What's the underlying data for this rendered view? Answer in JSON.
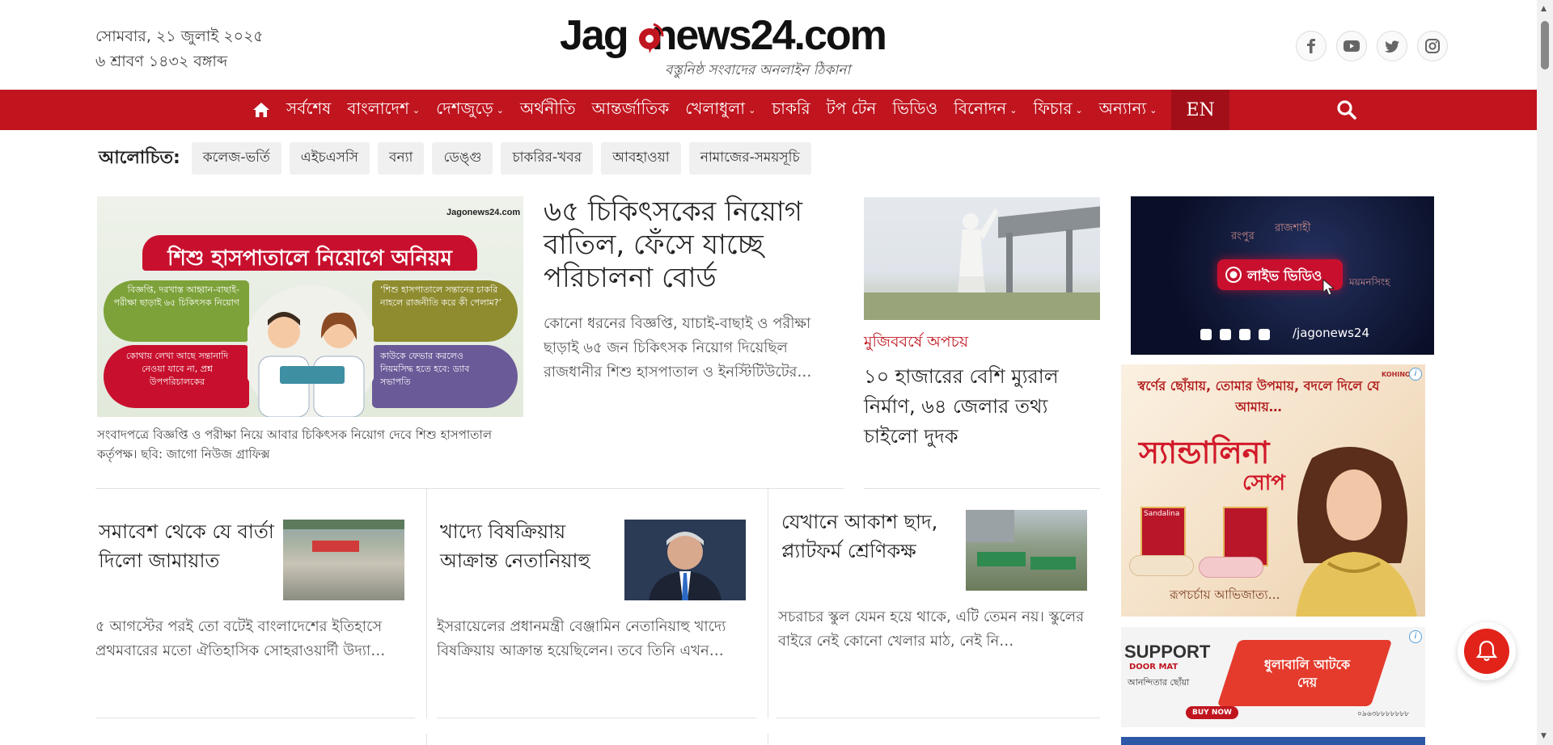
{
  "header": {
    "date_bn": "সোমবার, ২১ জুলাই ২০২৫",
    "date_bangla": "৬ শ্রাবণ ১৪৩২ বঙ্গাব্দ",
    "logo": {
      "part1": "Jag",
      "part2": "news24.com",
      "tagline": "বস্তুনিষ্ঠ সংবাদের অনলাইন ঠিকানা"
    },
    "socials": [
      {
        "icon": "facebook-icon"
      },
      {
        "icon": "youtube-icon"
      },
      {
        "icon": "twitter-icon"
      },
      {
        "icon": "instagram-icon"
      }
    ]
  },
  "nav": {
    "home_icon": "home-icon",
    "items": [
      {
        "label": "সর্বশেষ",
        "dropdown": false
      },
      {
        "label": "বাংলাদেশ",
        "dropdown": true
      },
      {
        "label": "দেশজুড়ে",
        "dropdown": true
      },
      {
        "label": "অর্থনীতি",
        "dropdown": false
      },
      {
        "label": "আন্তর্জাতিক",
        "dropdown": false
      },
      {
        "label": "খেলাধুলা",
        "dropdown": true
      },
      {
        "label": "চাকরি",
        "dropdown": false
      },
      {
        "label": "টপ টেন",
        "dropdown": false
      },
      {
        "label": "ভিডিও",
        "dropdown": false
      },
      {
        "label": "বিনোদন",
        "dropdown": true
      },
      {
        "label": "ফিচার",
        "dropdown": true
      },
      {
        "label": "অন্যান্য",
        "dropdown": true
      }
    ],
    "en_label": "EN",
    "search_icon": "search-icon"
  },
  "trending": {
    "label": "আলোচিত:",
    "tags": [
      "কলেজ-ভর্তি",
      "এইচএসসি",
      "বন্যা",
      "ডেঙ্গু",
      "চাকরির-খবর",
      "আবহাওয়া",
      "নামাজের-সময়সূচি"
    ]
  },
  "lead": {
    "image_headline": "শিশু হাসপাতালে নিয়োগে অনিয়ম",
    "image_watermark": "Jagonews24.com",
    "bubbles": [
      "বিজ্ঞপ্তি, দরখাস্ত আহ্বান-বাছাই-পরীক্ষা ছাড়াই ৬৫ চিকিৎসক নিয়োগ",
      "‘শিশু হাসপাতালে সন্তানের চাকরি নাহলে রাজনীতি করে কী পেলাম?’",
      "কোথায় লেখা আছে সন্তানাদি নেওয়া যাবে না, প্রশ্ন উপপরিচালকের",
      "কাউকে ফেভার করলেও নিয়মসিদ্ধ হতে হবে: ড্যাব সভাপতি"
    ],
    "caption": "সংবাদপত্রে বিজ্ঞপ্তি ও পরীক্ষা নিয়ে আবার চিকিৎসক নিয়োগ দেবে শিশু হাসপাতাল কর্তৃপক্ষ। ছবি: জাগো নিউজ গ্রাফিক্স",
    "title": "৬৫ চিকিৎসকের নিয়োগ বাতিল, ফেঁসে যাচ্ছে পরিচালনা বোর্ড",
    "summary": "কোনো ধরনের বিজ্ঞপ্তি, যাচাই-বাছাই ও পরীক্ষা ছাড়াই ৬৫ জন চিকিৎসক নিয়োগ দিয়েছিল রাজধানীর শিশু হাসপাতাল ও ইনস্টিটিউটের…"
  },
  "side_story": {
    "kicker": "মুজিববর্ষে অপচয়",
    "title": "১০ হাজারের বেশি ম্যুরাল নির্মাণ, ৬৪ জেলার তথ্য চাইলো দুদক"
  },
  "cards": [
    {
      "title": "সমাবেশ থেকে যে বার্তা দিলো জামায়াত",
      "summary": "৫ আগস্টের পরই তো বটেই বাংলাদেশের ইতিহাসে প্রথমবারের মতো ঐতিহাসিক সোহরাওয়ার্দী উদ্যা…"
    },
    {
      "title": "খাদ্যে বিষক্রিয়ায় আক্রান্ত নেতানিয়াহু",
      "summary": "ইসরায়েলের প্রধানমন্ত্রী বেঞ্জামিন নেতানিয়াহু খাদ্যে বিষক্রিয়ায় আক্রান্ত হয়েছিলেন। তবে তিনি এখন…"
    },
    {
      "title": "যেখানে আকাশ ছাদ, প্ল্যাটফর্ম শ্রেণিকক্ষ",
      "summary": "সচরাচর স্কুল যেমন হয়ে থাকে, এটি তেমন নয়। স্কুলের বাইরে নেই কোনো খেলার মাঠ, নেই নি…"
    }
  ],
  "ads": {
    "live": {
      "label": "লাইভ ভিডিও",
      "handle": "/jagonews24",
      "regions": [
        "রংপুর",
        "রাজশাহী",
        "ময়মনসিংহ"
      ]
    },
    "soap": {
      "tagline": "স্বর্ণের ছোঁয়ায়, তোমার উপমায়, বদলে দিলে যে আমায়…",
      "brand": "স্যান্ডালিনা",
      "product": "সোপ",
      "slogan": "রূপচর্চায় আভিজাত্য…",
      "pack_label": "Sandalina",
      "company": "KOHINOOR"
    },
    "doormat": {
      "brand": "SUPPORT",
      "sub": "DOOR MAT",
      "tagline": "আনন্দিতার ছোঁয়া",
      "mat_text": "ধুলাবালি আটকে দেয়",
      "cta": "BUY NOW",
      "phone": "০৯৬৩৮৮৮৮৮৮৮"
    }
  },
  "colors": {
    "brand_red": "#c0151f",
    "fab_red": "#e2231a"
  }
}
